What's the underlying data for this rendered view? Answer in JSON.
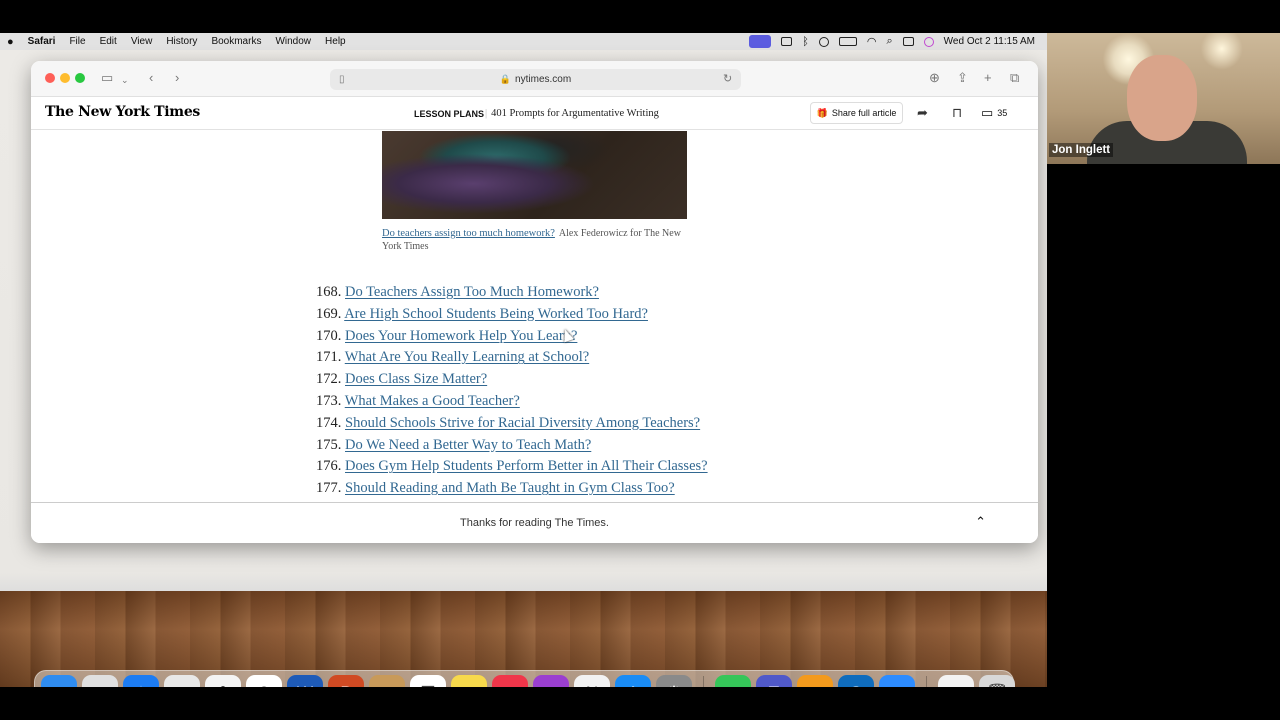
{
  "menubar": {
    "app_name": "Safari",
    "menus": [
      "File",
      "Edit",
      "View",
      "History",
      "Bookmarks",
      "Window",
      "Help"
    ],
    "clock": "Wed Oct 2  11:15 AM"
  },
  "browser": {
    "url": "nytimes.com"
  },
  "nyt": {
    "logo": "The New York Times",
    "section": "LESSON PLANS",
    "headline": "401 Prompts for Argumentative Writing",
    "share_label": "Share full article",
    "comment_count": "35"
  },
  "article": {
    "caption_link": "Do teachers assign too much homework?",
    "caption_credit": "Alex Federowicz for The New York Times",
    "prompts": [
      {
        "num": "168.",
        "text": "Do Teachers Assign Too Much Homework?"
      },
      {
        "num": "169.",
        "text": "Are High School Students Being Worked Too Hard?"
      },
      {
        "num": "170.",
        "text": "Does Your Homework Help You Learn?"
      },
      {
        "num": "171.",
        "text": "What Are You Really Learning at School?"
      },
      {
        "num": "172.",
        "text": "Does Class Size Matter?"
      },
      {
        "num": "173.",
        "text": "What Makes a Good Teacher?"
      },
      {
        "num": "174.",
        "text": "Should Schools Strive for Racial Diversity Among Teachers?"
      },
      {
        "num": "175.",
        "text": "Do We Need a Better Way to Teach Math?"
      },
      {
        "num": "176.",
        "text": "Does Gym Help Students Perform Better in All Their Classes?"
      },
      {
        "num": "177.",
        "text": "Should Reading and Math Be Taught in Gym Class Too?"
      }
    ],
    "footer_text": "Thanks for reading The Times."
  },
  "dock": {
    "apps": [
      {
        "icon": "finder-icon",
        "color": "#2f8cf0",
        "glyph": "☺"
      },
      {
        "icon": "launchpad-icon",
        "color": "#e0e0e0",
        "glyph": "▦"
      },
      {
        "icon": "safari-icon",
        "color": "#1d7cf2",
        "glyph": "✦"
      },
      {
        "icon": "chrome-icon",
        "color": "#e8e8e8",
        "glyph": "◉"
      },
      {
        "icon": "photos-icon",
        "color": "#f4f4f4",
        "glyph": "✿"
      },
      {
        "icon": "calendar-icon",
        "color": "#ffffff",
        "glyph": "2"
      },
      {
        "icon": "word-icon",
        "color": "#1e5bb8",
        "glyph": "W"
      },
      {
        "icon": "powerpoint-icon",
        "color": "#d04a23",
        "glyph": "P"
      },
      {
        "icon": "contacts-icon",
        "color": "#c89a5a",
        "glyph": "☻"
      },
      {
        "icon": "reminders-icon",
        "color": "#ffffff",
        "glyph": "☰"
      },
      {
        "icon": "notes-icon",
        "color": "#f7d94c",
        "glyph": "≡"
      },
      {
        "icon": "music-icon",
        "color": "#f0364a",
        "glyph": "♫"
      },
      {
        "icon": "podcasts-icon",
        "color": "#9b3fd0",
        "glyph": "◎"
      },
      {
        "icon": "news-icon",
        "color": "#f2f2f2",
        "glyph": "N"
      },
      {
        "icon": "app-store-icon",
        "color": "#1a8cf5",
        "glyph": "A"
      },
      {
        "icon": "system-settings-icon",
        "color": "#8a8a8a",
        "glyph": "⚙"
      },
      {
        "icon": "messages-icon",
        "color": "#35c659",
        "glyph": "✉"
      },
      {
        "icon": "teams-icon",
        "color": "#5059c9",
        "glyph": "T"
      },
      {
        "icon": "books-icon",
        "color": "#f39a1d",
        "glyph": "▤"
      },
      {
        "icon": "outlook-icon",
        "color": "#0f6cbd",
        "glyph": "O"
      },
      {
        "icon": "zoom-icon",
        "color": "#2d8cff",
        "glyph": "zoom"
      },
      {
        "icon": "document-icon",
        "color": "#f3f3f3",
        "glyph": "▤"
      },
      {
        "icon": "trash-icon",
        "color": "#d8d8d8",
        "glyph": "🗑"
      }
    ]
  },
  "webcam": {
    "name": "Jon Inglett"
  },
  "colors": {
    "link": "#326891",
    "menubar": "#e2e2e2",
    "zoom_indicator": "#5b5ce0"
  }
}
